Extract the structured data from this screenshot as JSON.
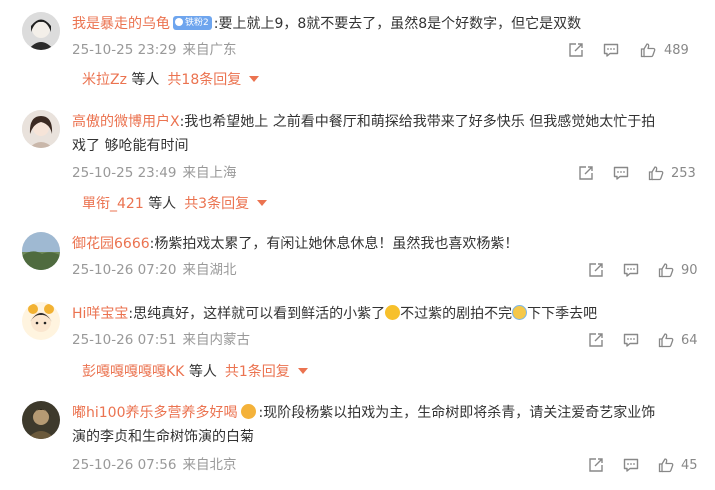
{
  "colors": {
    "username": "#eb7350",
    "meta": "#999999",
    "badge": "#6ea5ee"
  },
  "icons": {
    "share": "share-icon",
    "comment": "comment-icon",
    "like": "thumbs-up-icon",
    "expand": "chevron-down-icon"
  },
  "comments": [
    {
      "user": "我是暴走的乌龟",
      "badge": "铁粉2",
      "text": ":要上就上9，8就不要去了，虽然8是个好数字，但它是双数",
      "time": "25-10-25 23:29",
      "location": "来自广东",
      "likes": "489",
      "reply_users": "米拉Zz",
      "reply_suffix": "等人",
      "reply_count": "共18条回复"
    },
    {
      "user": "高傲的微博用户X",
      "text_line1": ":我也希望她上 之前看中餐厅和萌探给我带来了好多快乐 但我感觉她太忙于拍",
      "text_line2": "戏了 够呛能有时间",
      "time": "25-10-25 23:49",
      "location": "来自上海",
      "likes": "253",
      "reply_users": "單衔_421",
      "reply_suffix": "等人",
      "reply_count": "共3条回复"
    },
    {
      "user": "御花园6666",
      "text": ":杨紫拍戏太累了，有闲让她休息休息！虽然我也喜欢杨紫！",
      "time": "25-10-26 07:20",
      "location": "来自湖北",
      "likes": "90"
    },
    {
      "user": "Hi咩宝宝",
      "text_a": ":思纯真好，这样就可以看到鲜活的小紫了",
      "text_b": "不过紫的剧拍不完",
      "text_c": "下下季去吧",
      "time": "25-10-26 07:51",
      "location": "来自内蒙古",
      "likes": "64",
      "reply_users": "彭嘎嘎嘎嘎嘎KK",
      "reply_suffix": "等人",
      "reply_count": "共1条回复"
    },
    {
      "user": "嘟hi100养乐多营养多好喝",
      "text_line1": ":现阶段杨紫以拍戏为主，生命树即将杀青，请关注爱奇艺家业饰",
      "text_line2": "演的李贞和生命树饰演的白菊",
      "time": "25-10-26 07:56",
      "location": "来自北京",
      "likes": "45"
    }
  ]
}
